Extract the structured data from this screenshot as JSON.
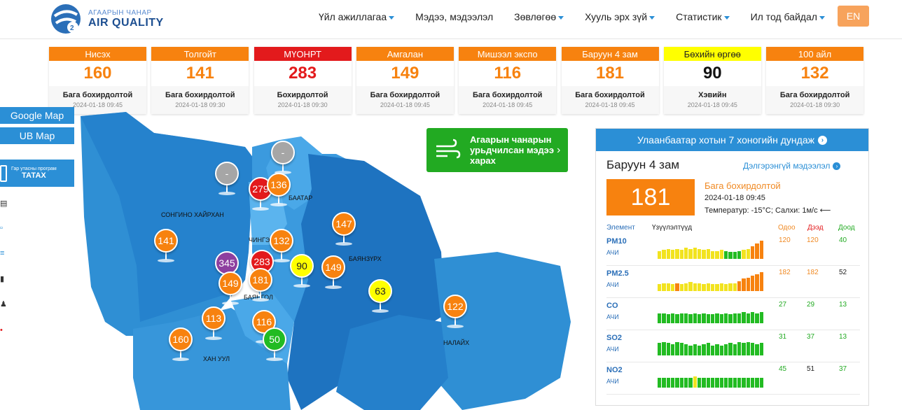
{
  "header": {
    "logo_sub": "АГААРЫН ЧАНАР",
    "logo_main": "AIR QUALITY",
    "nav": [
      {
        "label": "Үйл ажиллагаа",
        "dropdown": true
      },
      {
        "label": "Мэдээ, мэдээлэл",
        "dropdown": false
      },
      {
        "label": "Зөвлөгөө",
        "dropdown": true
      },
      {
        "label": "Хууль эрх зүй",
        "dropdown": true
      },
      {
        "label": "Статистик",
        "dropdown": true
      },
      {
        "label": "Ил тод байдал",
        "dropdown": true
      }
    ],
    "lang": "EN"
  },
  "stations": [
    {
      "name": "Нисэх",
      "value": "160",
      "status": "Бага бохирдолтой",
      "time": "2024-01-18 09:45",
      "color": "#f7820f",
      "value_color": "#f7820f"
    },
    {
      "name": "Толгойт",
      "value": "141",
      "status": "Бага бохирдолтой",
      "time": "2024-01-18 09:30",
      "color": "#f7820f",
      "value_color": "#f7820f"
    },
    {
      "name": "МҮОНРТ",
      "value": "283",
      "status": "Бохирдолтой",
      "time": "2024-01-18 09:30",
      "color": "#e31a1c",
      "value_color": "#e31a1c"
    },
    {
      "name": "Амгалан",
      "value": "149",
      "status": "Бага бохирдолтой",
      "time": "2024-01-18 09:45",
      "color": "#f7820f",
      "value_color": "#f7820f"
    },
    {
      "name": "Мишээл экспо",
      "value": "116",
      "status": "Бага бохирдолтой",
      "time": "2024-01-18 09:45",
      "color": "#f7820f",
      "value_color": "#f7820f"
    },
    {
      "name": "Баруун 4 зам",
      "value": "181",
      "status": "Бага бохирдолтой",
      "time": "2024-01-18 09:45",
      "color": "#f7820f",
      "value_color": "#f7820f"
    },
    {
      "name": "Бөхийн өргөө",
      "value": "90",
      "status": "Хэвийн",
      "time": "2024-01-18 09:45",
      "color": "#ffff00",
      "value_color": "#111111",
      "head_text_color": "#222222"
    },
    {
      "name": "100 айл",
      "value": "132",
      "status": "Бага бохирдолтой",
      "time": "2024-01-18 09:30",
      "color": "#f7820f",
      "value_color": "#f7820f"
    }
  ],
  "side": {
    "google_map": "Google Map",
    "ub_map": "UB Map",
    "app_line1": "Гар утасны програм",
    "app_line2": "ТАТАХ"
  },
  "map": {
    "districts": [
      "СОНГИНО ХАЙРХАН",
      "ЧИНГЭ",
      "БААТАР",
      "БАЯНЗҮРХ",
      "БАЯНГОЛ",
      "ХАН УУЛ",
      "НАЛАЙХ"
    ],
    "markers": [
      {
        "label": "-",
        "color": "#a6a6a6"
      },
      {
        "label": "-",
        "color": "#a6a6a6"
      },
      {
        "label": "279",
        "color": "#e31a1c"
      },
      {
        "label": "136",
        "color": "#f7820f"
      },
      {
        "label": "141",
        "color": "#f7820f"
      },
      {
        "label": "147",
        "color": "#f7820f"
      },
      {
        "label": "132",
        "color": "#f7820f"
      },
      {
        "label": "345",
        "color": "#8e3f9f"
      },
      {
        "label": "283",
        "color": "#e31a1c"
      },
      {
        "label": "90",
        "color": "#ffff00"
      },
      {
        "label": "149",
        "color": "#f7820f"
      },
      {
        "label": "149",
        "color": "#f7820f"
      },
      {
        "label": "181",
        "color": "#f7820f"
      },
      {
        "label": "63",
        "color": "#ffff00"
      },
      {
        "label": "122",
        "color": "#f7820f"
      },
      {
        "label": "113",
        "color": "#f7820f"
      },
      {
        "label": "116",
        "color": "#f7820f"
      },
      {
        "label": "160",
        "color": "#f7820f"
      },
      {
        "label": "50",
        "color": "#22bb22"
      }
    ]
  },
  "forecast": {
    "text": "Агаарын чанарын урьдчилсан мэдээ харах"
  },
  "panel": {
    "header": "Улаанбаатар хотын 7 хоногийн дундаж",
    "station": "Баруун 4 зам",
    "more": "Дэлгэрэнгүй мэдээлэл",
    "aqi": "181",
    "status": "Бага бохирдолтой",
    "time": "2024-01-18 09:45",
    "weather": "Температур: -15°C; Салхи: 1м/с ⟵",
    "col_element": "Элемент",
    "col_indicators": "Үзүүлэлтүүд",
    "col_now": "Одоо",
    "col_max": "Дээд",
    "col_min": "Доод",
    "pollutants": [
      {
        "name": "PM10",
        "unit": "АЧИ",
        "now": "120",
        "max": "120",
        "min": "40",
        "now_color": "#f08a24",
        "max_color": "#f08a24",
        "min_color": "#22aa22",
        "bars": [
          {
            "v": 0.35,
            "c": "#f2e31f"
          },
          {
            "v": 0.4,
            "c": "#f2e31f"
          },
          {
            "v": 0.45,
            "c": "#f2e31f"
          },
          {
            "v": 0.4,
            "c": "#f2e31f"
          },
          {
            "v": 0.45,
            "c": "#f2e31f"
          },
          {
            "v": 0.4,
            "c": "#f2e31f"
          },
          {
            "v": 0.5,
            "c": "#f2e31f"
          },
          {
            "v": 0.45,
            "c": "#f2e31f"
          },
          {
            "v": 0.5,
            "c": "#f2e31f"
          },
          {
            "v": 0.45,
            "c": "#f2e31f"
          },
          {
            "v": 0.4,
            "c": "#f2e31f"
          },
          {
            "v": 0.45,
            "c": "#f2e31f"
          },
          {
            "v": 0.35,
            "c": "#f2e31f"
          },
          {
            "v": 0.35,
            "c": "#f2e31f"
          },
          {
            "v": 0.4,
            "c": "#f2e31f"
          },
          {
            "v": 0.35,
            "c": "#22bb22"
          },
          {
            "v": 0.3,
            "c": "#22bb22"
          },
          {
            "v": 0.3,
            "c": "#22bb22"
          },
          {
            "v": 0.35,
            "c": "#22bb22"
          },
          {
            "v": 0.4,
            "c": "#f2e31f"
          },
          {
            "v": 0.45,
            "c": "#f2e31f"
          },
          {
            "v": 0.55,
            "c": "#f7820f"
          },
          {
            "v": 0.7,
            "c": "#f7820f"
          },
          {
            "v": 0.8,
            "c": "#f7820f"
          }
        ]
      },
      {
        "name": "PM2.5",
        "unit": "АЧИ",
        "now": "182",
        "max": "182",
        "min": "52",
        "now_color": "#f08a24",
        "max_color": "#f08a24",
        "min_color": "#222222",
        "bars": [
          {
            "v": 0.3,
            "c": "#f2e31f"
          },
          {
            "v": 0.35,
            "c": "#f2e31f"
          },
          {
            "v": 0.35,
            "c": "#f2e31f"
          },
          {
            "v": 0.3,
            "c": "#f2e31f"
          },
          {
            "v": 0.35,
            "c": "#f7820f"
          },
          {
            "v": 0.3,
            "c": "#f2e31f"
          },
          {
            "v": 0.35,
            "c": "#f2e31f"
          },
          {
            "v": 0.4,
            "c": "#f2e31f"
          },
          {
            "v": 0.35,
            "c": "#f2e31f"
          },
          {
            "v": 0.35,
            "c": "#f2e31f"
          },
          {
            "v": 0.3,
            "c": "#f2e31f"
          },
          {
            "v": 0.35,
            "c": "#f2e31f"
          },
          {
            "v": 0.3,
            "c": "#f2e31f"
          },
          {
            "v": 0.3,
            "c": "#f2e31f"
          },
          {
            "v": 0.35,
            "c": "#f2e31f"
          },
          {
            "v": 0.3,
            "c": "#f2e31f"
          },
          {
            "v": 0.35,
            "c": "#f2e31f"
          },
          {
            "v": 0.35,
            "c": "#f2e31f"
          },
          {
            "v": 0.45,
            "c": "#f7820f"
          },
          {
            "v": 0.55,
            "c": "#f7820f"
          },
          {
            "v": 0.6,
            "c": "#f7820f"
          },
          {
            "v": 0.7,
            "c": "#f7820f"
          },
          {
            "v": 0.75,
            "c": "#f7820f"
          },
          {
            "v": 0.85,
            "c": "#f7820f"
          }
        ]
      },
      {
        "name": "CO",
        "unit": "АЧИ",
        "now": "27",
        "max": "29",
        "min": "13",
        "now_color": "#22aa22",
        "max_color": "#22aa22",
        "min_color": "#22aa22",
        "bars": [
          {
            "v": 0.45,
            "c": "#22bb22"
          },
          {
            "v": 0.45,
            "c": "#22bb22"
          },
          {
            "v": 0.4,
            "c": "#22bb22"
          },
          {
            "v": 0.45,
            "c": "#22bb22"
          },
          {
            "v": 0.4,
            "c": "#22bb22"
          },
          {
            "v": 0.45,
            "c": "#22bb22"
          },
          {
            "v": 0.45,
            "c": "#22bb22"
          },
          {
            "v": 0.4,
            "c": "#22bb22"
          },
          {
            "v": 0.45,
            "c": "#22bb22"
          },
          {
            "v": 0.4,
            "c": "#22bb22"
          },
          {
            "v": 0.45,
            "c": "#22bb22"
          },
          {
            "v": 0.4,
            "c": "#22bb22"
          },
          {
            "v": 0.4,
            "c": "#22bb22"
          },
          {
            "v": 0.45,
            "c": "#22bb22"
          },
          {
            "v": 0.4,
            "c": "#22bb22"
          },
          {
            "v": 0.45,
            "c": "#22bb22"
          },
          {
            "v": 0.4,
            "c": "#22bb22"
          },
          {
            "v": 0.45,
            "c": "#22bb22"
          },
          {
            "v": 0.45,
            "c": "#22bb22"
          },
          {
            "v": 0.5,
            "c": "#22bb22"
          },
          {
            "v": 0.45,
            "c": "#22bb22"
          },
          {
            "v": 0.5,
            "c": "#22bb22"
          },
          {
            "v": 0.45,
            "c": "#22bb22"
          },
          {
            "v": 0.5,
            "c": "#22bb22"
          }
        ]
      },
      {
        "name": "SO2",
        "unit": "АЧИ",
        "now": "31",
        "max": "37",
        "min": "13",
        "now_color": "#22aa22",
        "max_color": "#22aa22",
        "min_color": "#22aa22",
        "bars": [
          {
            "v": 0.55,
            "c": "#22bb22"
          },
          {
            "v": 0.6,
            "c": "#22bb22"
          },
          {
            "v": 0.55,
            "c": "#22bb22"
          },
          {
            "v": 0.5,
            "c": "#22bb22"
          },
          {
            "v": 0.6,
            "c": "#22bb22"
          },
          {
            "v": 0.55,
            "c": "#22bb22"
          },
          {
            "v": 0.5,
            "c": "#22bb22"
          },
          {
            "v": 0.45,
            "c": "#22bb22"
          },
          {
            "v": 0.5,
            "c": "#22bb22"
          },
          {
            "v": 0.45,
            "c": "#22bb22"
          },
          {
            "v": 0.5,
            "c": "#22bb22"
          },
          {
            "v": 0.55,
            "c": "#22bb22"
          },
          {
            "v": 0.45,
            "c": "#22bb22"
          },
          {
            "v": 0.5,
            "c": "#22bb22"
          },
          {
            "v": 0.45,
            "c": "#22bb22"
          },
          {
            "v": 0.5,
            "c": "#22bb22"
          },
          {
            "v": 0.55,
            "c": "#22bb22"
          },
          {
            "v": 0.5,
            "c": "#22bb22"
          },
          {
            "v": 0.6,
            "c": "#22bb22"
          },
          {
            "v": 0.55,
            "c": "#22bb22"
          },
          {
            "v": 0.6,
            "c": "#22bb22"
          },
          {
            "v": 0.55,
            "c": "#22bb22"
          },
          {
            "v": 0.5,
            "c": "#22bb22"
          },
          {
            "v": 0.55,
            "c": "#22bb22"
          }
        ]
      },
      {
        "name": "NO2",
        "unit": "АЧИ",
        "now": "45",
        "max": "51",
        "min": "37",
        "now_color": "#22aa22",
        "max_color": "#222222",
        "min_color": "#22aa22",
        "bars": [
          {
            "v": 0.45,
            "c": "#22bb22"
          },
          {
            "v": 0.45,
            "c": "#22bb22"
          },
          {
            "v": 0.45,
            "c": "#22bb22"
          },
          {
            "v": 0.45,
            "c": "#22bb22"
          },
          {
            "v": 0.45,
            "c": "#22bb22"
          },
          {
            "v": 0.45,
            "c": "#22bb22"
          },
          {
            "v": 0.45,
            "c": "#22bb22"
          },
          {
            "v": 0.45,
            "c": "#22bb22"
          },
          {
            "v": 0.5,
            "c": "#f2e31f"
          },
          {
            "v": 0.45,
            "c": "#22bb22"
          },
          {
            "v": 0.45,
            "c": "#22bb22"
          },
          {
            "v": 0.45,
            "c": "#22bb22"
          },
          {
            "v": 0.45,
            "c": "#22bb22"
          },
          {
            "v": 0.45,
            "c": "#22bb22"
          },
          {
            "v": 0.45,
            "c": "#22bb22"
          },
          {
            "v": 0.45,
            "c": "#22bb22"
          },
          {
            "v": 0.45,
            "c": "#22bb22"
          },
          {
            "v": 0.45,
            "c": "#22bb22"
          },
          {
            "v": 0.45,
            "c": "#22bb22"
          },
          {
            "v": 0.45,
            "c": "#22bb22"
          },
          {
            "v": 0.45,
            "c": "#22bb22"
          },
          {
            "v": 0.45,
            "c": "#22bb22"
          },
          {
            "v": 0.45,
            "c": "#22bb22"
          },
          {
            "v": 0.45,
            "c": "#22bb22"
          }
        ]
      }
    ]
  }
}
